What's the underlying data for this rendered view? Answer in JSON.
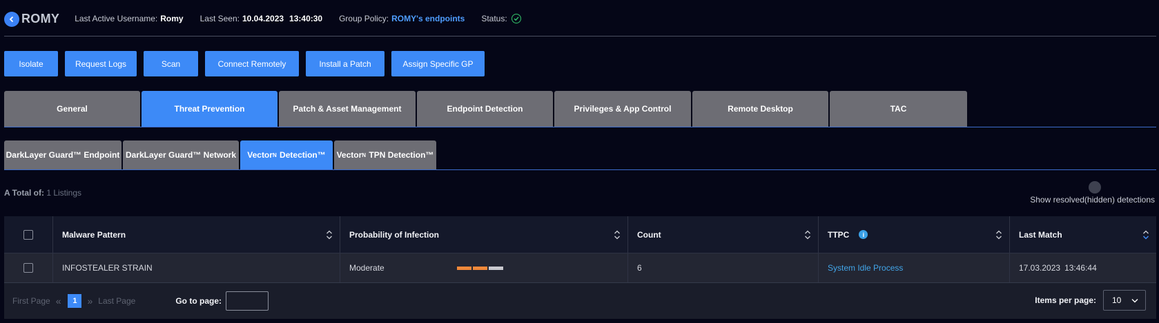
{
  "header": {
    "device_name": "ROMY",
    "last_active_label": "Last Active Username:",
    "last_active_value": "Romy",
    "last_seen_label": "Last Seen:",
    "last_seen_value": "10.04.2023",
    "last_seen_time": "13:40:30",
    "group_policy_label": "Group Policy:",
    "group_policy_value": "ROMY's endpoints",
    "status_label": "Status:",
    "status_icon": "check-circle-icon",
    "status_color": "#33c46b"
  },
  "actions": [
    {
      "label": "Isolate"
    },
    {
      "label": "Request Logs"
    },
    {
      "label": "Scan"
    },
    {
      "label": "Connect Remotely"
    },
    {
      "label": "Install a Patch"
    },
    {
      "label": "Assign Specific GP"
    }
  ],
  "main_tabs": [
    {
      "label": "General",
      "active": false
    },
    {
      "label": "Threat Prevention",
      "active": true
    },
    {
      "label": "Patch & Asset Management",
      "active": false
    },
    {
      "label": "Endpoint Detection",
      "active": false
    },
    {
      "label": "Privileges & App Control",
      "active": false
    },
    {
      "label": "Remote Desktop",
      "active": false
    },
    {
      "label": "TAC",
      "active": false
    }
  ],
  "sub_tabs": [
    {
      "label": "DarkLayer Guard™ Endpoint",
      "active": false
    },
    {
      "label": "DarkLayer Guard™ Network",
      "active": false
    },
    {
      "prefix": "Vector",
      "sup": "N",
      "label": " Detection™",
      "active": true
    },
    {
      "prefix": "Vector",
      "sup": "N",
      "label": " TPN Detection™",
      "active": false
    }
  ],
  "totals": {
    "label": "A Total of:",
    "count": "1 Listings"
  },
  "show_resolved": {
    "label": "Show resolved(hidden) detections",
    "enabled": false
  },
  "table": {
    "columns": [
      "Malware Pattern",
      "Probability of Infection",
      "Count",
      "TTPC",
      "Last Match"
    ],
    "rows": [
      {
        "malware_pattern": "INFOSTEALER STRAIN",
        "probability": "Moderate",
        "probability_level": 2,
        "probability_max": 3,
        "probability_colors": [
          "#f0883a",
          "#f0883a",
          "#c9c9cf"
        ],
        "count": "6",
        "ttpc": "System Idle Process",
        "last_match_date": "17.03.2023",
        "last_match_time": "13:46:44"
      }
    ]
  },
  "pagination": {
    "first_label": "First Page",
    "current_page": "1",
    "last_label": "Last Page",
    "goto_label": "Go to page:",
    "goto_value": "",
    "items_per_page_label": "Items per page:",
    "items_per_page_value": "10"
  },
  "colors": {
    "accent": "#3d8af7",
    "tab_inactive": "#6d6d74",
    "link": "#42a5e8",
    "background": "#050617"
  }
}
